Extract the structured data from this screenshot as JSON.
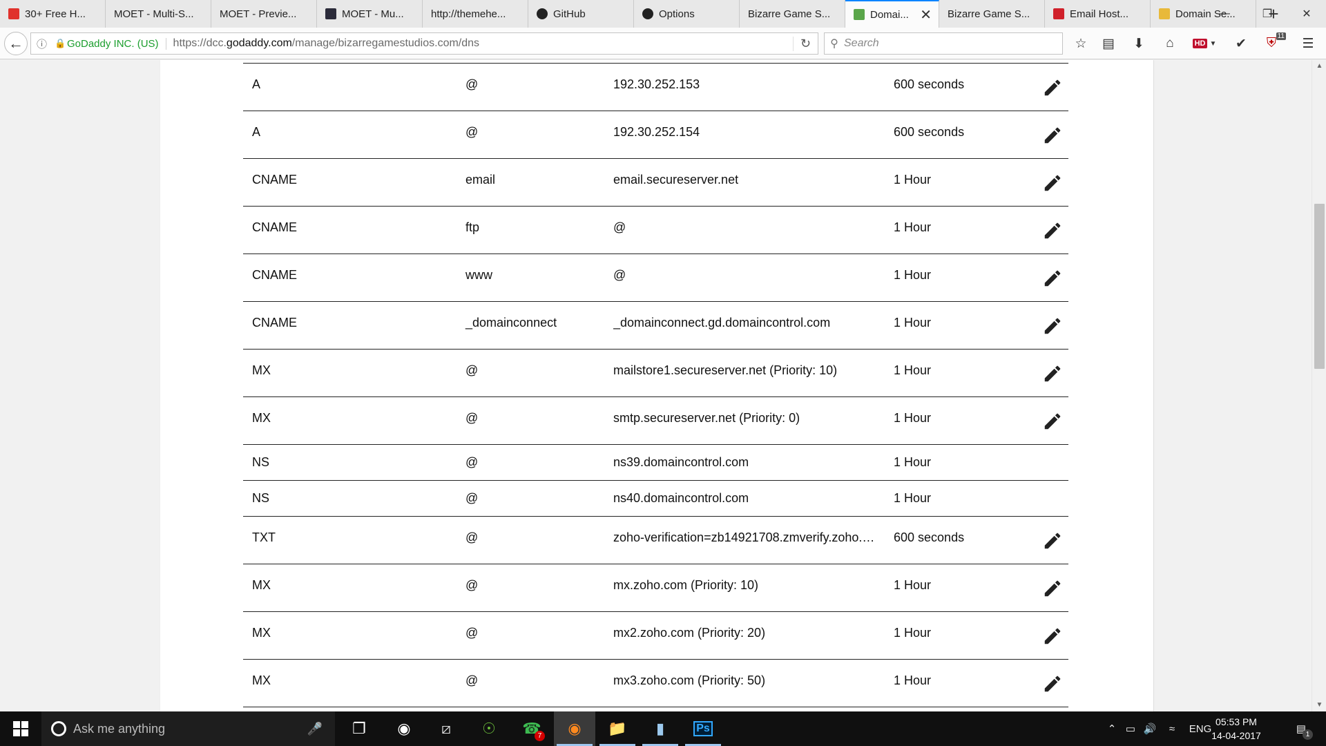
{
  "browser": {
    "tabs": [
      {
        "label": "30+ Free H...",
        "icon": "red-app-icon"
      },
      {
        "label": "MOET - Multi-S...",
        "icon": ""
      },
      {
        "label": "MOET - Previe...",
        "icon": ""
      },
      {
        "label": "MOET - Mu...",
        "icon": "dark-square-icon"
      },
      {
        "label": "http://themehe...",
        "icon": ""
      },
      {
        "label": "GitHub",
        "icon": "github-icon"
      },
      {
        "label": "Options",
        "icon": "github-icon"
      },
      {
        "label": "Bizarre Game S...",
        "icon": ""
      },
      {
        "label": "Domai...",
        "icon": "godaddy-icon",
        "active": true
      },
      {
        "label": "Bizarre Game S...",
        "icon": ""
      },
      {
        "label": "Email Host...",
        "icon": "zoho-icon"
      },
      {
        "label": "Domain Se...",
        "icon": "envelope-icon"
      }
    ],
    "identity": "GoDaddy INC. (US)",
    "url_prefix": "https://dcc.",
    "url_domain": "godaddy.com",
    "url_path": "/manage/bizarregamestudios.com/dns",
    "search_placeholder": "Search",
    "hd_label": "HD",
    "ublock_count": "11"
  },
  "dns_records": [
    {
      "type": "A",
      "name": "@",
      "value": "192.30.252.153",
      "ttl": "600 seconds",
      "editable": true
    },
    {
      "type": "A",
      "name": "@",
      "value": "192.30.252.154",
      "ttl": "600 seconds",
      "editable": true
    },
    {
      "type": "CNAME",
      "name": "email",
      "value": "email.secureserver.net",
      "ttl": "1 Hour",
      "editable": true
    },
    {
      "type": "CNAME",
      "name": "ftp",
      "value": "@",
      "ttl": "1 Hour",
      "editable": true
    },
    {
      "type": "CNAME",
      "name": "www",
      "value": "@",
      "ttl": "1 Hour",
      "editable": true
    },
    {
      "type": "CNAME",
      "name": "_domainconnect",
      "value": "_domainconnect.gd.domaincontrol.com",
      "ttl": "1 Hour",
      "editable": true
    },
    {
      "type": "MX",
      "name": "@",
      "value": "mailstore1.secureserver.net (Priority: 10)",
      "ttl": "1 Hour",
      "editable": true
    },
    {
      "type": "MX",
      "name": "@",
      "value": "smtp.secureserver.net (Priority: 0)",
      "ttl": "1 Hour",
      "editable": true
    },
    {
      "type": "NS",
      "name": "@",
      "value": "ns39.domaincontrol.com",
      "ttl": "1 Hour",
      "editable": false
    },
    {
      "type": "NS",
      "name": "@",
      "value": "ns40.domaincontrol.com",
      "ttl": "1 Hour",
      "editable": false
    },
    {
      "type": "TXT",
      "name": "@",
      "value": "zoho-verification=zb14921708.zmverify.zoho.c...",
      "ttl": "600 seconds",
      "editable": true
    },
    {
      "type": "MX",
      "name": "@",
      "value": "mx.zoho.com (Priority: 10)",
      "ttl": "1 Hour",
      "editable": true
    },
    {
      "type": "MX",
      "name": "@",
      "value": "mx2.zoho.com (Priority: 20)",
      "ttl": "1 Hour",
      "editable": true
    },
    {
      "type": "MX",
      "name": "@",
      "value": "mx3.zoho.com (Priority: 50)",
      "ttl": "1 Hour",
      "editable": true
    }
  ],
  "taskbar": {
    "search_placeholder": "Ask me anything",
    "whatsapp_badge": "7",
    "language": "ENG",
    "time": "05:53 PM",
    "date": "14-04-2017",
    "notification_count": "1"
  }
}
